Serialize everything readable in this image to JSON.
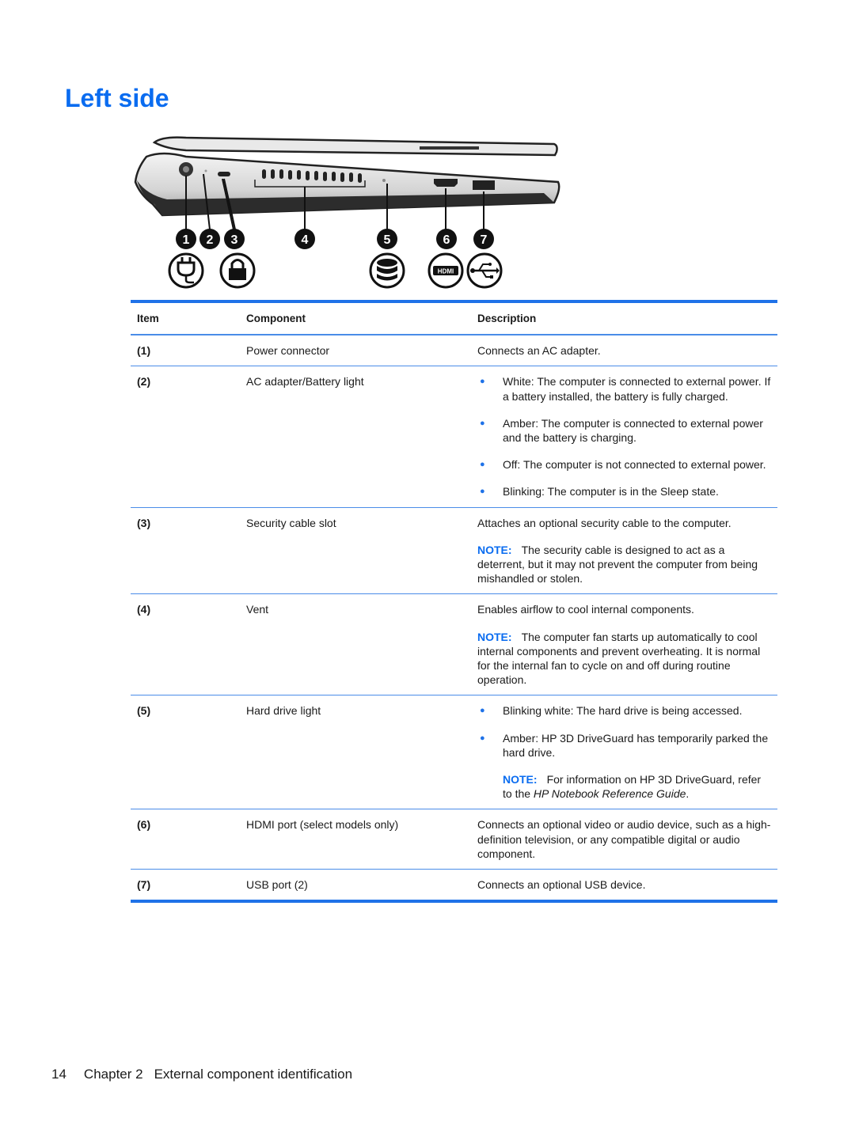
{
  "page": {
    "title": "Left side",
    "footer": {
      "page_number": "14",
      "chapter": "Chapter 2",
      "chapter_title": "External component identification"
    }
  },
  "figure": {
    "callouts": [
      "1",
      "2",
      "3",
      "4",
      "5",
      "6",
      "7"
    ],
    "icons": [
      "power-plug-icon",
      "lock-icon",
      "hard-drive-icon",
      "hdmi-icon",
      "usb-icon"
    ],
    "hdmi_icon_text": "HDMI"
  },
  "table": {
    "headers": {
      "item": "Item",
      "component": "Component",
      "description": "Description"
    },
    "note_label": "NOTE:",
    "rows": [
      {
        "item": "(1)",
        "component": "Power connector",
        "description": "Connects an AC adapter."
      },
      {
        "item": "(2)",
        "component": "AC adapter/Battery light",
        "bullets": [
          "White: The computer is connected to external power. If a battery installed, the battery is fully charged.",
          "Amber: The computer is connected to external power and the battery is charging.",
          "Off: The computer is not connected to external power.",
          "Blinking: The computer is in the Sleep state."
        ]
      },
      {
        "item": "(3)",
        "component": "Security cable slot",
        "description": "Attaches an optional security cable to the computer.",
        "note": "The security cable is designed to act as a deterrent, but it may not prevent the computer from being mishandled or stolen."
      },
      {
        "item": "(4)",
        "component": "Vent",
        "description": "Enables airflow to cool internal components.",
        "note": "The computer fan starts up automatically to cool internal components and prevent overheating. It is normal for the internal fan to cycle on and off during routine operation."
      },
      {
        "item": "(5)",
        "component": "Hard drive light",
        "bullets": [
          "Blinking white: The hard drive is being accessed.",
          "Amber: HP 3D DriveGuard has temporarily parked the hard drive."
        ],
        "note_prefix": "For information on HP 3D DriveGuard, refer to the ",
        "note_italic": "HP Notebook Reference Guide",
        "note_suffix": "."
      },
      {
        "item": "(6)",
        "component": "HDMI port (select models only)",
        "description": "Connects an optional video or audio device, such as a high-definition television, or any compatible digital or audio component."
      },
      {
        "item": "(7)",
        "component": "USB port (2)",
        "description": "Connects an optional USB device."
      }
    ]
  }
}
